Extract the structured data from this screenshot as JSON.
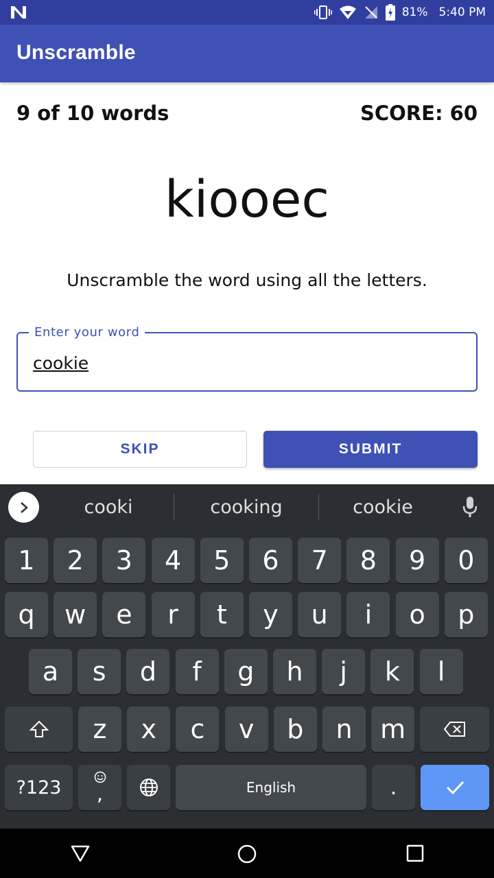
{
  "status_bar": {
    "battery": "81%",
    "time": "5:40 PM",
    "icons": [
      "n-logo-icon",
      "vibrate-icon",
      "wifi-icon",
      "no-signal-icon",
      "battery-charging-icon"
    ]
  },
  "app_bar": {
    "title": "Unscramble"
  },
  "game": {
    "progress": "9 of 10 words",
    "score": "SCORE: 60",
    "scrambled_word": "kiooec",
    "instructions": "Unscramble the word using all the letters."
  },
  "input": {
    "label": "Enter your word",
    "value": "cookie"
  },
  "buttons": {
    "skip": "SKIP",
    "submit": "SUBMIT"
  },
  "keyboard": {
    "suggestions": [
      "cooki",
      "cooking",
      "cookie"
    ],
    "number_row": [
      "1",
      "2",
      "3",
      "4",
      "5",
      "6",
      "7",
      "8",
      "9",
      "0"
    ],
    "row1": [
      "q",
      "w",
      "e",
      "r",
      "t",
      "y",
      "u",
      "i",
      "o",
      "p"
    ],
    "row2": [
      "a",
      "s",
      "d",
      "f",
      "g",
      "h",
      "j",
      "k",
      "l"
    ],
    "row3": [
      "z",
      "x",
      "c",
      "v",
      "b",
      "n",
      "m"
    ],
    "symbols_key": "?123",
    "comma_key": ",",
    "space_key": "English",
    "period_key": ".",
    "enter_color": "#5e97f6"
  },
  "theme": {
    "primary": "#3f51b5",
    "primary_dark": "#303f9f"
  }
}
